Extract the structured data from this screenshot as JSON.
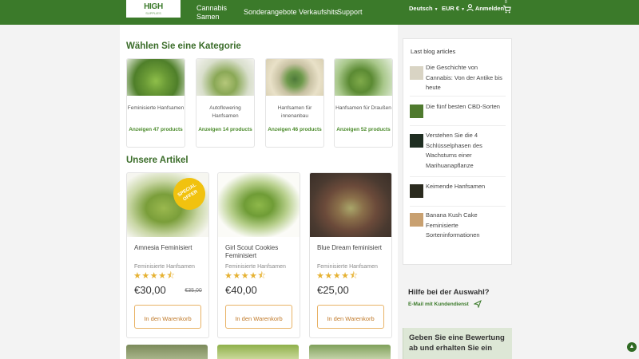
{
  "header": {
    "logo_line1": "HIGH",
    "logo_line2": "SUPPLIES",
    "nav": [
      {
        "label": "Cannabis Samen"
      },
      {
        "label": "Sonderangebote Verkaufshits"
      },
      {
        "label": "Support"
      }
    ],
    "language": "Deutsch",
    "currency": "EUR €",
    "login": "Anmelden",
    "cart_count": "0",
    "colors": {
      "header_bg": "#3b7a2a",
      "accent": "#4a8a2a",
      "button_border": "#e8b265",
      "stars": "#e6b233"
    }
  },
  "categories": {
    "title": "Wählen Sie eine Kategorie",
    "items": [
      {
        "name": "Feminisierte Hanfsamen",
        "link": "Anzeigen 47 products"
      },
      {
        "name": "Autoflowering Hanfsamen",
        "link": "Anzeigen 14 products"
      },
      {
        "name": "Hanfsamen für innenanbau",
        "link": "Anzeigen 46 products"
      },
      {
        "name": "Hanfsamen für Draußen",
        "link": "Anzeigen 52 products"
      }
    ]
  },
  "products": {
    "title": "Unsere Artikel",
    "items": [
      {
        "name": "Amnesia Feminisiert",
        "category": "Feminisierte Hanfsamen",
        "stars": "★★★★⯪",
        "rating": 4.5,
        "price": "€30,00",
        "old_price": "€35,00",
        "badge": "SPECIAL OFFER",
        "button": "In den Warenkorb"
      },
      {
        "name": "Girl Scout Cookies Feminisiert",
        "category": "Feminisierte Hanfsamen",
        "stars": "★★★★⯪",
        "rating": 4.5,
        "price": "€40,00",
        "button": "In den Warenkorb"
      },
      {
        "name": "Blue Dream feminisiert",
        "category": "Feminisierte Hanfsamen",
        "stars": "★★★★⯪",
        "rating": 4.5,
        "price": "€25,00",
        "button": "In den Warenkorb"
      }
    ]
  },
  "sidebar": {
    "blog_title": "Last blog articles",
    "articles": [
      {
        "title": "Die Geschichte von Cannabis: Von der Antike bis heute"
      },
      {
        "title": "Die fünf besten CBD-Sorten"
      },
      {
        "title": "Verstehen Sie die 4 Schlüsselphasen des Wachstums einer Marihuanapflanze"
      },
      {
        "title": "Keimende Hanfsamen"
      },
      {
        "title": "Banana Kush Cake Feminisierte Sorteninformationen"
      }
    ],
    "help_title": "Hilfe bei der Auswahl?",
    "help_link": "E-Mail mit Kundendienst",
    "review_text": "Geben Sie eine Bewertung ab und erhalten Sie ein"
  },
  "scroll_top_icon": "chevron-up-icon"
}
